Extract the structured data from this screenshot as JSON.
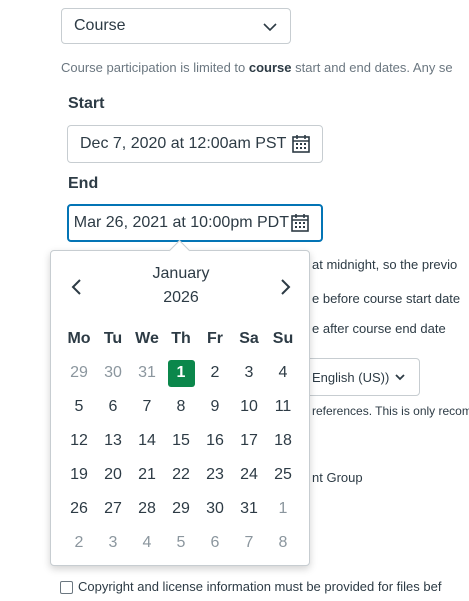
{
  "participation_select": {
    "value": "Course"
  },
  "participation_help": {
    "prefix": "Course participation is limited to ",
    "bold": "course",
    "suffix": " start and end dates. Any se"
  },
  "start": {
    "label": "Start",
    "value": "Dec 7, 2020 at 12:00am PST"
  },
  "end": {
    "label": "End",
    "value": "Mar 26, 2021 at 10:00pm PDT"
  },
  "background": {
    "midnight": "at midnight, so the previo",
    "before_start": "e before course start date",
    "after_end": "e after course end date",
    "language": "English (US))",
    "preferences": "references. This is only recom",
    "group": "nt Group",
    "copyright": "Copyright and license information must be provided for files bef"
  },
  "calendar": {
    "month": "January",
    "year": "2026",
    "weekdays": [
      "Mo",
      "Tu",
      "We",
      "Th",
      "Fr",
      "Sa",
      "Su"
    ],
    "selected_day": "1",
    "weeks": [
      [
        {
          "d": "29",
          "out": true
        },
        {
          "d": "30",
          "out": true
        },
        {
          "d": "31",
          "out": true
        },
        {
          "d": "1",
          "sel": true
        },
        {
          "d": "2"
        },
        {
          "d": "3"
        },
        {
          "d": "4"
        }
      ],
      [
        {
          "d": "5"
        },
        {
          "d": "6"
        },
        {
          "d": "7"
        },
        {
          "d": "8"
        },
        {
          "d": "9"
        },
        {
          "d": "10"
        },
        {
          "d": "11"
        }
      ],
      [
        {
          "d": "12"
        },
        {
          "d": "13"
        },
        {
          "d": "14"
        },
        {
          "d": "15"
        },
        {
          "d": "16"
        },
        {
          "d": "17"
        },
        {
          "d": "18"
        }
      ],
      [
        {
          "d": "19"
        },
        {
          "d": "20"
        },
        {
          "d": "21"
        },
        {
          "d": "22"
        },
        {
          "d": "23"
        },
        {
          "d": "24"
        },
        {
          "d": "25"
        }
      ],
      [
        {
          "d": "26"
        },
        {
          "d": "27"
        },
        {
          "d": "28"
        },
        {
          "d": "29"
        },
        {
          "d": "30"
        },
        {
          "d": "31"
        },
        {
          "d": "1",
          "out": true
        }
      ],
      [
        {
          "d": "2",
          "out": true
        },
        {
          "d": "3",
          "out": true
        },
        {
          "d": "4",
          "out": true
        },
        {
          "d": "5",
          "out": true
        },
        {
          "d": "6",
          "out": true
        },
        {
          "d": "7",
          "out": true
        },
        {
          "d": "8",
          "out": true
        }
      ]
    ]
  },
  "colors": {
    "accent": "#0374b5",
    "selected": "#0b874b",
    "text": "#2d3b45",
    "muted": "#6b7780"
  },
  "icons": {
    "dropdown": "chevron-down-icon",
    "calendar": "calendar-icon",
    "prev": "chevron-left-icon",
    "next": "chevron-right-icon"
  }
}
